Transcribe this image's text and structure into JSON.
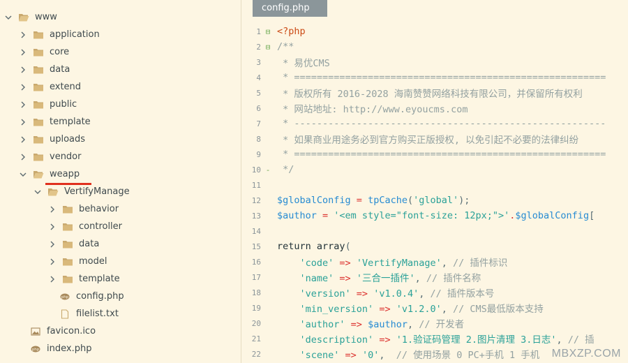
{
  "tree": {
    "root": {
      "label": "www"
    },
    "items": [
      {
        "label": "application"
      },
      {
        "label": "core"
      },
      {
        "label": "data"
      },
      {
        "label": "extend"
      },
      {
        "label": "public"
      },
      {
        "label": "template"
      },
      {
        "label": "uploads"
      },
      {
        "label": "vendor"
      },
      {
        "label": "weapp"
      },
      {
        "label": "VertifyManage"
      },
      {
        "label": "behavior"
      },
      {
        "label": "controller"
      },
      {
        "label": "data"
      },
      {
        "label": "model"
      },
      {
        "label": "template"
      },
      {
        "label": "config.php"
      },
      {
        "label": "filelist.txt"
      },
      {
        "label": "favicon.ico"
      },
      {
        "label": "index.php"
      }
    ]
  },
  "editor": {
    "tab_label": "config.php",
    "lines": [
      {
        "n": "1",
        "fold": "⊟",
        "segs": [
          [
            "tag",
            "<?php"
          ]
        ]
      },
      {
        "n": "2",
        "fold": "⊟",
        "segs": [
          [
            "cm",
            "/**"
          ]
        ]
      },
      {
        "n": "3",
        "fold": "",
        "segs": [
          [
            "cm",
            " * 易优CMS"
          ]
        ]
      },
      {
        "n": "4",
        "fold": "",
        "segs": [
          [
            "cm",
            " * ======================================================="
          ]
        ]
      },
      {
        "n": "5",
        "fold": "",
        "segs": [
          [
            "cm",
            " * 版权所有 2016-2028 海南赞赞网络科技有限公司，并保留所有权利"
          ]
        ]
      },
      {
        "n": "6",
        "fold": "",
        "segs": [
          [
            "cm",
            " * 网站地址: http://www.eyoucms.com"
          ]
        ]
      },
      {
        "n": "7",
        "fold": "",
        "segs": [
          [
            "cm",
            " * -------------------------------------------------------"
          ]
        ]
      },
      {
        "n": "8",
        "fold": "",
        "segs": [
          [
            "cm",
            " * 如果商业用途务必到官方购买正版授权, 以免引起不必要的法律纠纷"
          ]
        ]
      },
      {
        "n": "9",
        "fold": "",
        "segs": [
          [
            "cm",
            " * ======================================================="
          ]
        ]
      },
      {
        "n": "10",
        "fold": "-",
        "segs": [
          [
            "cm",
            " */"
          ]
        ]
      },
      {
        "n": "11",
        "fold": "",
        "segs": []
      },
      {
        "n": "12",
        "fold": "",
        "segs": [
          [
            "var",
            "$globalConfig"
          ],
          [
            "op",
            " = "
          ],
          [
            "var",
            "tpCache"
          ],
          [
            "pl",
            "("
          ],
          [
            "str",
            "'global'"
          ],
          [
            "pl",
            ");"
          ]
        ]
      },
      {
        "n": "13",
        "fold": "",
        "segs": [
          [
            "var",
            "$author"
          ],
          [
            "op",
            " = "
          ],
          [
            "str",
            "'<em style=\"font-size: 12px;\">'"
          ],
          [
            "op",
            "."
          ],
          [
            "var",
            "$globalConfig"
          ],
          [
            "pl",
            "["
          ]
        ]
      },
      {
        "n": "14",
        "fold": "",
        "segs": []
      },
      {
        "n": "15",
        "fold": "",
        "segs": [
          [
            "kw",
            "return"
          ],
          [
            "pl",
            " "
          ],
          [
            "kw",
            "array"
          ],
          [
            "pl",
            "("
          ]
        ]
      },
      {
        "n": "16",
        "fold": "",
        "segs": [
          [
            "pl",
            "    "
          ],
          [
            "str",
            "'code'"
          ],
          [
            "op",
            " => "
          ],
          [
            "str",
            "'VertifyManage'"
          ],
          [
            "pl",
            ", "
          ],
          [
            "cm",
            "// 插件标识"
          ]
        ]
      },
      {
        "n": "17",
        "fold": "",
        "segs": [
          [
            "pl",
            "    "
          ],
          [
            "str",
            "'name'"
          ],
          [
            "op",
            " => "
          ],
          [
            "str",
            "'三合一插件'"
          ],
          [
            "pl",
            ", "
          ],
          [
            "cm",
            "// 插件名称"
          ]
        ]
      },
      {
        "n": "18",
        "fold": "",
        "segs": [
          [
            "pl",
            "    "
          ],
          [
            "str",
            "'version'"
          ],
          [
            "op",
            " => "
          ],
          [
            "str",
            "'v1.0.4'"
          ],
          [
            "pl",
            ", "
          ],
          [
            "cm",
            "// 插件版本号"
          ]
        ]
      },
      {
        "n": "19",
        "fold": "",
        "segs": [
          [
            "pl",
            "    "
          ],
          [
            "str",
            "'min_version'"
          ],
          [
            "op",
            " => "
          ],
          [
            "str",
            "'v1.2.0'"
          ],
          [
            "pl",
            ", "
          ],
          [
            "cm",
            "// CMS最低版本支持"
          ]
        ]
      },
      {
        "n": "20",
        "fold": "",
        "segs": [
          [
            "pl",
            "    "
          ],
          [
            "str",
            "'author'"
          ],
          [
            "op",
            " => "
          ],
          [
            "var",
            "$author"
          ],
          [
            "pl",
            ", "
          ],
          [
            "cm",
            "// 开发者"
          ]
        ]
      },
      {
        "n": "21",
        "fold": "",
        "segs": [
          [
            "pl",
            "    "
          ],
          [
            "str",
            "'description'"
          ],
          [
            "op",
            " => "
          ],
          [
            "str",
            "'1.验证码管理 2.图片清理 3.日志'"
          ],
          [
            "pl",
            ", "
          ],
          [
            "cm",
            "// 插"
          ]
        ]
      },
      {
        "n": "22",
        "fold": "",
        "segs": [
          [
            "pl",
            "    "
          ],
          [
            "str",
            "'scene'"
          ],
          [
            "op",
            " => "
          ],
          [
            "str",
            "'0'"
          ],
          [
            "pl",
            ",  "
          ],
          [
            "cm",
            "// 使用场景 0 PC+手机 1 手机"
          ]
        ]
      }
    ]
  },
  "watermark": "MBXZP.COM"
}
